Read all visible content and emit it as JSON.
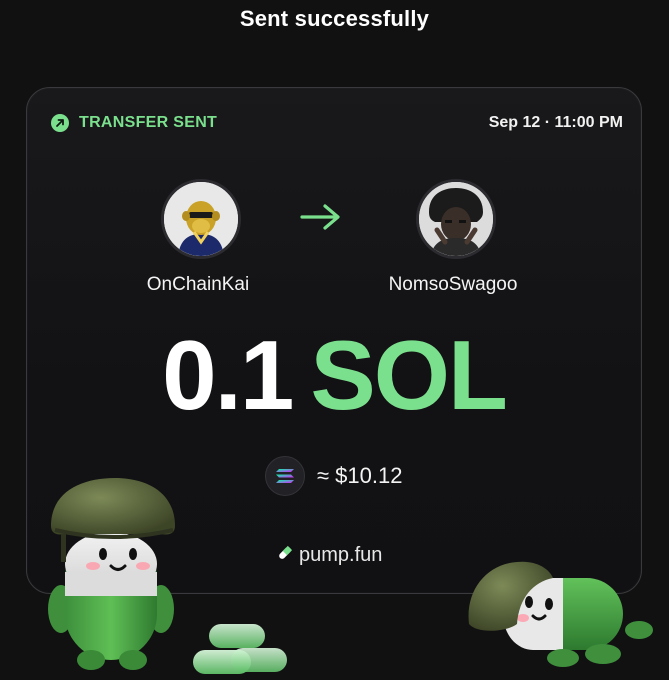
{
  "header": {
    "title": "Sent successfully"
  },
  "card": {
    "status_label": "TRANSFER SENT",
    "timestamp": "Sep 12 · 11:00 PM",
    "sender": {
      "name": "OnChainKai"
    },
    "recipient": {
      "name": "NomsoSwagoo"
    },
    "amount": {
      "value": "0.1",
      "ticker": "SOL"
    },
    "fiat": {
      "approx_value": "≈ $10.12"
    },
    "brand": {
      "label": "pump.fun"
    }
  },
  "colors": {
    "accent": "#7be08d",
    "background": "#111112",
    "card_border": "#3a3a3e"
  },
  "icons": [
    "arrow-up-right-icon",
    "arrow-right-icon",
    "solana-icon",
    "pill-icon"
  ]
}
